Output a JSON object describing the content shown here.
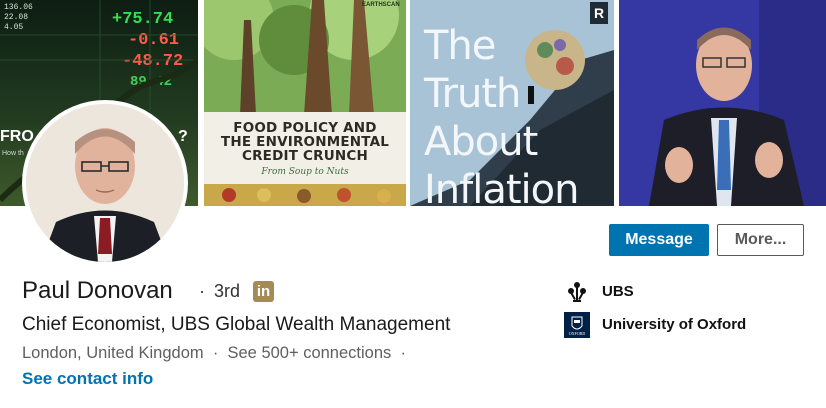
{
  "banner": {
    "tile1": {
      "book_title_fragment": "FRO",
      "book_title_end": "?",
      "book_sub_fragment": "How th",
      "tickers": [
        "+75.74",
        "-0.61",
        "-48.72",
        "89.42"
      ],
      "small_tickers": [
        "136.06",
        "22.08",
        "4.05"
      ]
    },
    "tile2": {
      "publisher": "EARTHSCAN",
      "title_lines": [
        "FOOD POLICY AND",
        "THE ENVIRONMENTAL",
        "CREDIT CRUNCH"
      ],
      "subtitle": "From Soup to Nuts"
    },
    "tile3": {
      "title_lines": [
        "The",
        "Truth",
        "About",
        "Inflation"
      ],
      "publisher_logo": "R"
    },
    "tile4": {}
  },
  "actions": {
    "message_label": "Message",
    "more_label": "More..."
  },
  "profile": {
    "name": "Paul Donovan",
    "separator": "·",
    "degree": "3rd",
    "badge": "in",
    "headline": "Chief Economist, UBS Global Wealth Management",
    "location": "London, United Kingdom",
    "connections": "See 500+ connections",
    "contact_link": "See contact info"
  },
  "sidebar": {
    "items": [
      {
        "label": "UBS",
        "icon": "ubs-keys-icon"
      },
      {
        "label": "University of Oxford",
        "icon": "oxford-crest-icon"
      }
    ]
  },
  "colors": {
    "primary": "#0073b1",
    "badge_gold": "#a58a55",
    "oxford_blue": "#002147"
  }
}
